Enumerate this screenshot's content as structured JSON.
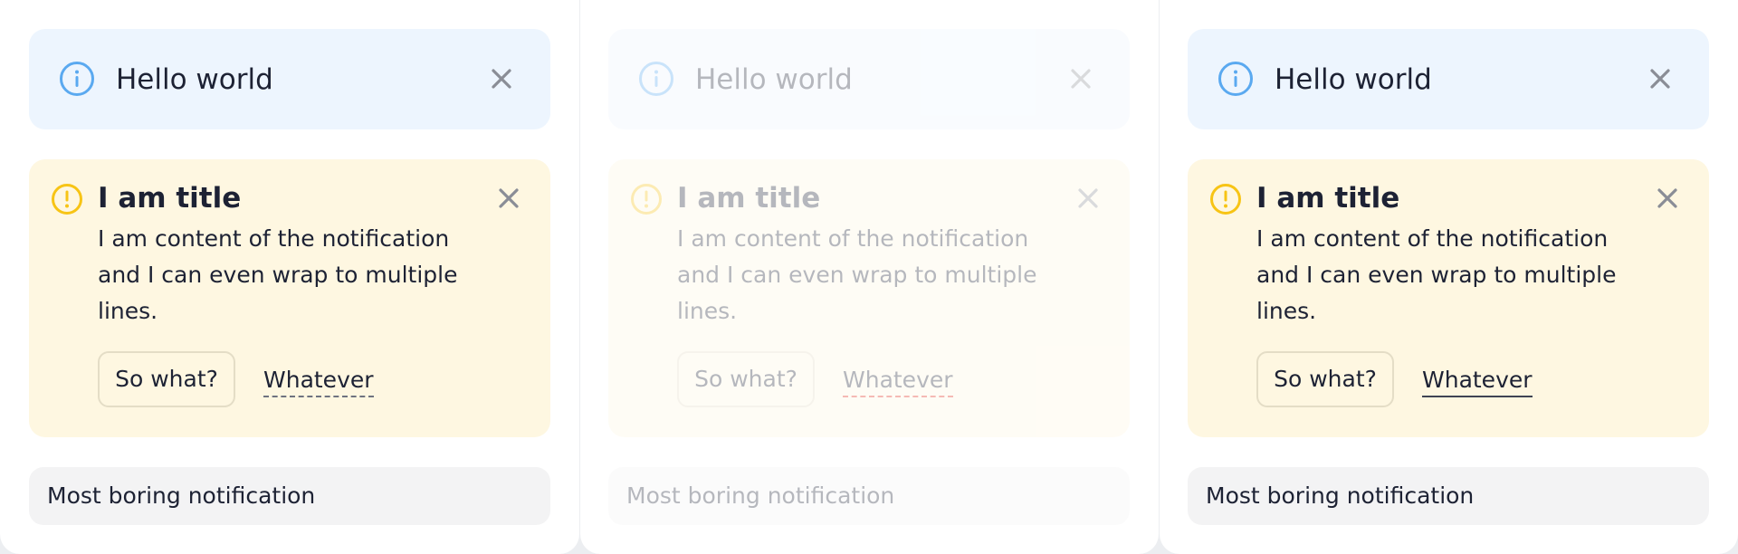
{
  "colors": {
    "info_background": "#edf5fe",
    "info_icon": "#5aa9f0",
    "warning_background": "#fef7e1",
    "warning_icon": "#f7c415",
    "plain_background": "#f3f3f4",
    "text": "#1d2234",
    "close_icon": "#8a8d96"
  },
  "variants": [
    {
      "info": {
        "icon": "info-icon",
        "message": "Hello world",
        "close_icon": "close-icon"
      },
      "warning": {
        "icon": "warning-icon",
        "title": "I am title",
        "content": "I am content of the notification and I can even wrap to multiple lines.",
        "primary_button": "So what?",
        "secondary_link": "Whatever",
        "close_icon": "close-icon"
      },
      "plain": {
        "message": "Most boring notification"
      }
    },
    {
      "info": {
        "icon": "info-icon",
        "message": "Hello world",
        "close_icon": "close-icon"
      },
      "warning": {
        "icon": "warning-icon",
        "title": "I am title",
        "content": "I am content of the notification and I can even wrap to multiple lines.",
        "primary_button": "So what?",
        "secondary_link": "Whatever",
        "close_icon": "close-icon"
      },
      "plain": {
        "message": "Most boring notification"
      }
    },
    {
      "info": {
        "icon": "info-icon",
        "message": "Hello world",
        "close_icon": "close-icon"
      },
      "warning": {
        "icon": "warning-icon",
        "title": "I am title",
        "content": "I am content of the notification and I can even wrap to multiple lines.",
        "primary_button": "So what?",
        "secondary_link": "Whatever",
        "close_icon": "close-icon"
      },
      "plain": {
        "message": "Most boring notification"
      }
    }
  ]
}
